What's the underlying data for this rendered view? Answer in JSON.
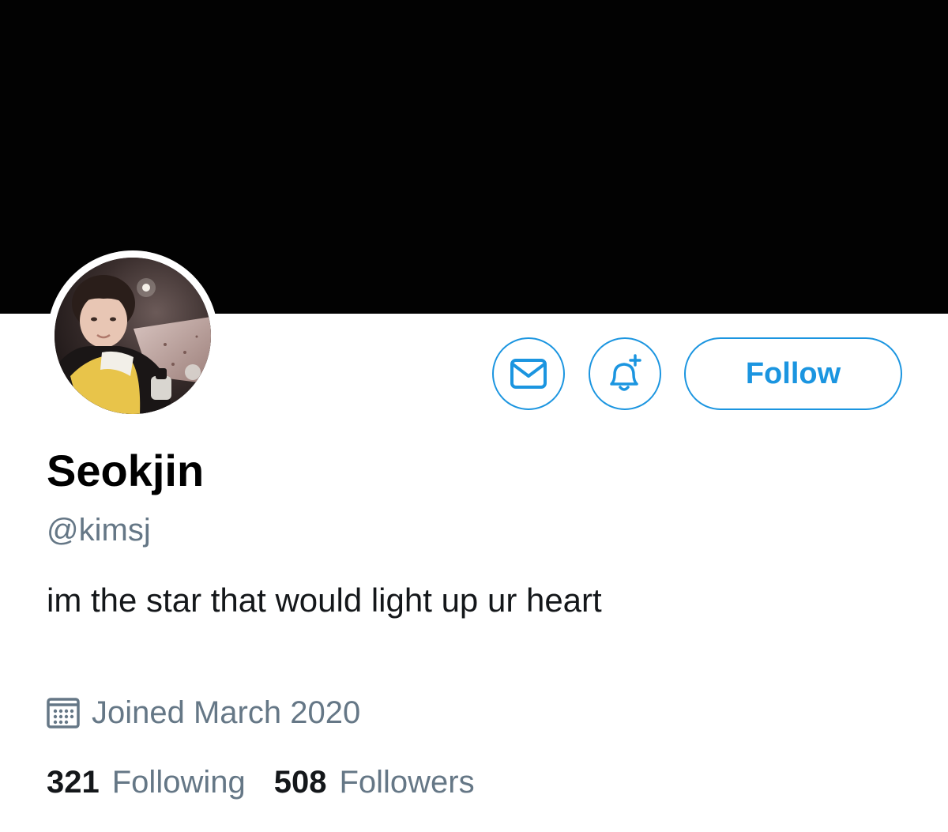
{
  "profile": {
    "display_name": "Seokjin",
    "handle": "@kimsj",
    "bio": "im the star that would light up ur heart",
    "joined": "Joined March 2020",
    "avatar_icon": "profile-photo"
  },
  "actions": {
    "message_icon": "envelope-icon",
    "notify_icon": "bell-plus-icon",
    "follow_label": "Follow"
  },
  "stats": {
    "following_count": "321",
    "following_label": "Following",
    "followers_count": "508",
    "followers_label": "Followers"
  },
  "colors": {
    "accent": "#1b95e0",
    "secondary_text": "#657786",
    "banner": "#020202"
  }
}
